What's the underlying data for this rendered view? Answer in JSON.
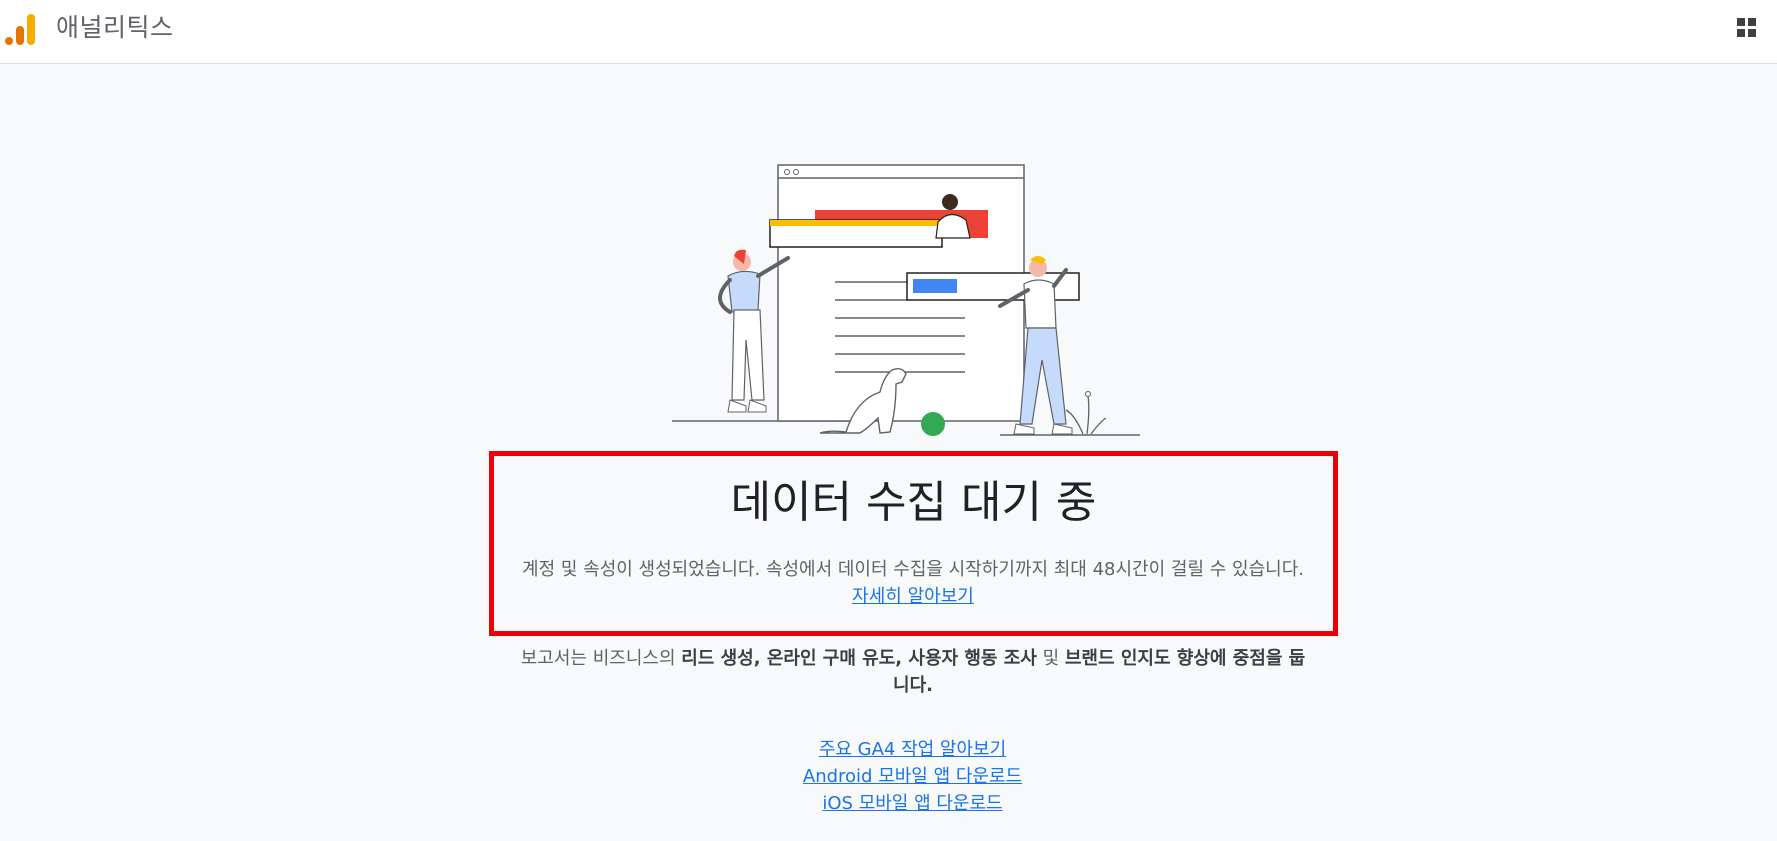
{
  "header": {
    "app_title": "애널리틱스",
    "logo_icon": "analytics-bars-icon",
    "apps_icon": "apps-grid-icon"
  },
  "main": {
    "heading": "데이터 수집 대기 중",
    "description": "계정 및 속성이 생성되었습니다. 속성에서 데이터 수집을 시작하기까지 최대 48시간이 걸릴 수 있습니다.",
    "learn_more_link": "자세히 알아보기",
    "reports_text": {
      "prefix": "보고서는 비즈니스의 ",
      "bold1": "리드 생성, 온라인 구매 유도, 사용자 행동 조사",
      "mid": " 및 ",
      "bold2": "브랜드 인지도 향상에 중점을 둡니다."
    },
    "links": [
      "주요 GA4 작업 알아보기",
      "Android 모바일 앱 다운로드",
      "iOS 모바일 앱 다운로드"
    ]
  },
  "colors": {
    "accent_link": "#1a73e8",
    "highlight_border": "#e8000b",
    "logo_orange": "#f9ab00",
    "logo_dark_orange": "#e37400"
  }
}
